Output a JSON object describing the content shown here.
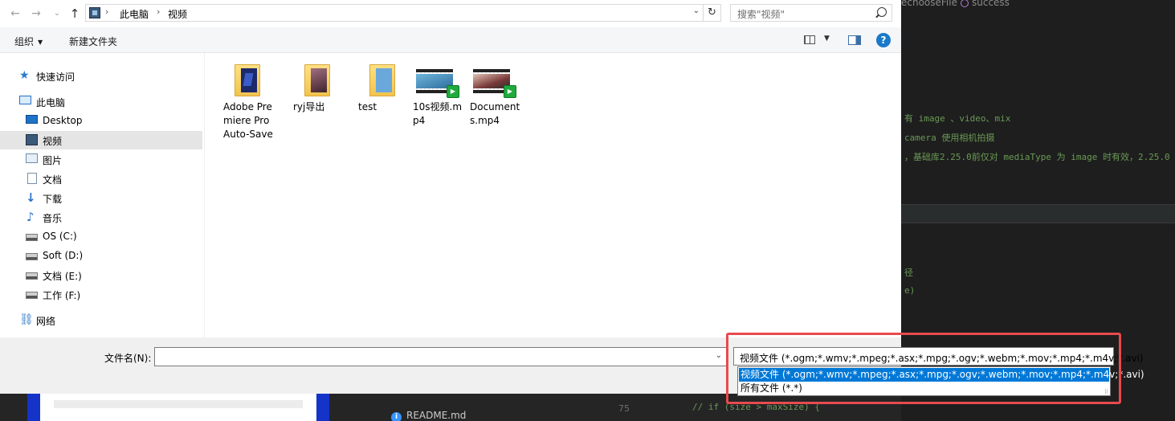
{
  "editor": {
    "breadcrumb_left": "echooseFile",
    "breadcrumb_right": "success",
    "code_lines": [
      "有 image 、video、mix",
      " camera 使用相机拍摄",
      "，基础库2.25.0前仅对 mediaType 为 image 时有效，2.25.0"
    ],
    "fragment_1": "径",
    "fragment_2": "e)"
  },
  "background": {
    "readme": "README.md",
    "line_number": "75",
    "code_bottom": "// if (size > maxSize) {"
  },
  "address_bar": {
    "segments": [
      "此电脑",
      "视频"
    ],
    "search_placeholder": "搜索\"视频\""
  },
  "toolbar": {
    "organize_label": "组织",
    "new_folder_label": "新建文件夹"
  },
  "nav": {
    "items": [
      {
        "label": "快速访问",
        "icon": "star-icon"
      },
      {
        "label": "此电脑",
        "icon": "computer-icon"
      },
      {
        "label": "Desktop",
        "icon": "desktop-icon"
      },
      {
        "label": "视频",
        "icon": "video-folder-icon",
        "selected": true
      },
      {
        "label": "图片",
        "icon": "pictures-icon"
      },
      {
        "label": "文档",
        "icon": "documents-icon"
      },
      {
        "label": "下载",
        "icon": "download-icon"
      },
      {
        "label": "音乐",
        "icon": "music-icon"
      },
      {
        "label": "OS (C:)",
        "icon": "drive-icon"
      },
      {
        "label": "Soft (D:)",
        "icon": "drive-icon"
      },
      {
        "label": "文档 (E:)",
        "icon": "drive-icon"
      },
      {
        "label": "工作 (F:)",
        "icon": "drive-icon"
      },
      {
        "label": "网络",
        "icon": "network-icon"
      }
    ]
  },
  "files": [
    {
      "name": "Adobe Premiere Pro Auto-Save",
      "kind": "folder"
    },
    {
      "name": "ryj导出",
      "kind": "folder"
    },
    {
      "name": "test",
      "kind": "folder"
    },
    {
      "name": "10s视频.mp4",
      "kind": "video"
    },
    {
      "name": "Documents.mp4",
      "kind": "video"
    }
  ],
  "bottom": {
    "filename_label": "文件名(N):",
    "filename_value": "",
    "filetype_selected": "视频文件 (*.ogm;*.wmv;*.mpeg;*.asx;*.mpg;*.ogv;*.webm;*.mov;*.mp4;*.m4v;*.avi)",
    "filetype_options": [
      "视频文件 (*.ogm;*.wmv;*.mpeg;*.asx;*.mpg;*.ogv;*.webm;*.mov;*.mp4;*.m4v;*.avi)",
      "所有文件 (*.*)"
    ]
  },
  "colors": {
    "highlight_box": "#e84a4e",
    "selected_option": "#0078d7",
    "editor_bg": "#1e1e1e"
  }
}
